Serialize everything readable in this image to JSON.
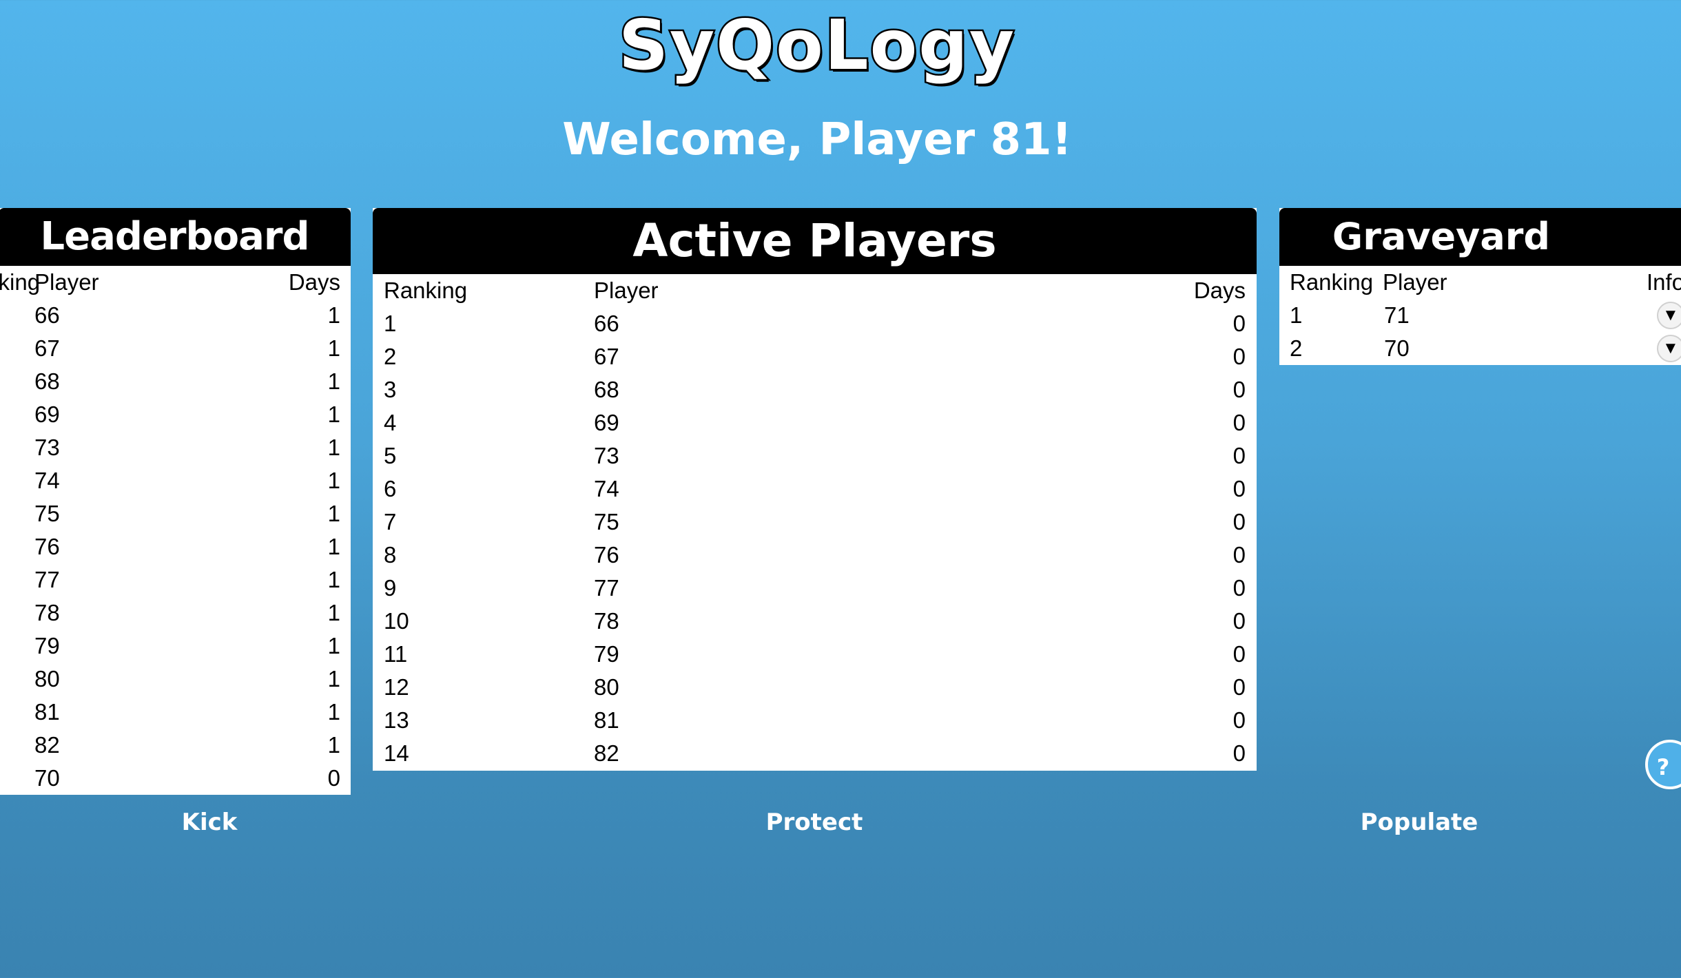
{
  "app": {
    "title": "SyQoLogy",
    "welcome": "Welcome, Player 81!"
  },
  "leaderboard": {
    "title": "Leaderboard",
    "columns": {
      "ranking": "Ranking",
      "player": "Player",
      "days": "Days"
    },
    "rows": [
      {
        "player": "66",
        "days": "1"
      },
      {
        "player": "67",
        "days": "1"
      },
      {
        "player": "68",
        "days": "1"
      },
      {
        "player": "69",
        "days": "1"
      },
      {
        "player": "73",
        "days": "1"
      },
      {
        "player": "74",
        "days": "1"
      },
      {
        "player": "75",
        "days": "1"
      },
      {
        "player": "76",
        "days": "1"
      },
      {
        "player": "77",
        "days": "1"
      },
      {
        "player": "78",
        "days": "1"
      },
      {
        "player": "79",
        "days": "1"
      },
      {
        "player": "80",
        "days": "1"
      },
      {
        "player": "81",
        "days": "1"
      },
      {
        "player": "82",
        "days": "1"
      },
      {
        "player": "70",
        "days": "0"
      }
    ]
  },
  "active_players": {
    "title": "Active Players",
    "columns": {
      "ranking": "Ranking",
      "player": "Player",
      "days": "Days"
    },
    "rows": [
      {
        "ranking": "1",
        "player": "66",
        "days": "0"
      },
      {
        "ranking": "2",
        "player": "67",
        "days": "0"
      },
      {
        "ranking": "3",
        "player": "68",
        "days": "0"
      },
      {
        "ranking": "4",
        "player": "69",
        "days": "0"
      },
      {
        "ranking": "5",
        "player": "73",
        "days": "0"
      },
      {
        "ranking": "6",
        "player": "74",
        "days": "0"
      },
      {
        "ranking": "7",
        "player": "75",
        "days": "0"
      },
      {
        "ranking": "8",
        "player": "76",
        "days": "0"
      },
      {
        "ranking": "9",
        "player": "77",
        "days": "0"
      },
      {
        "ranking": "10",
        "player": "78",
        "days": "0"
      },
      {
        "ranking": "11",
        "player": "79",
        "days": "0"
      },
      {
        "ranking": "12",
        "player": "80",
        "days": "0"
      },
      {
        "ranking": "13",
        "player": "81",
        "days": "0"
      },
      {
        "ranking": "14",
        "player": "82",
        "days": "0"
      }
    ]
  },
  "graveyard": {
    "title": "Graveyard",
    "columns": {
      "ranking": "Ranking",
      "player": "Player",
      "info": "Info"
    },
    "rows": [
      {
        "ranking": "1",
        "player": "71",
        "info_icon": "▼"
      },
      {
        "ranking": "2",
        "player": "70",
        "info_icon": "▼"
      }
    ]
  },
  "actions": {
    "kick": "Kick",
    "protect": "Protect",
    "populate": "Populate",
    "help": "?"
  },
  "icons": {
    "help": "question-mark-icon",
    "info_toggle": "triangle-down-icon"
  },
  "colors": {
    "background_top": "#52b5ec",
    "background_bottom": "#3a83b1",
    "panel_header": "#000000",
    "panel_body": "#ffffff",
    "text_light": "#ffffff"
  }
}
